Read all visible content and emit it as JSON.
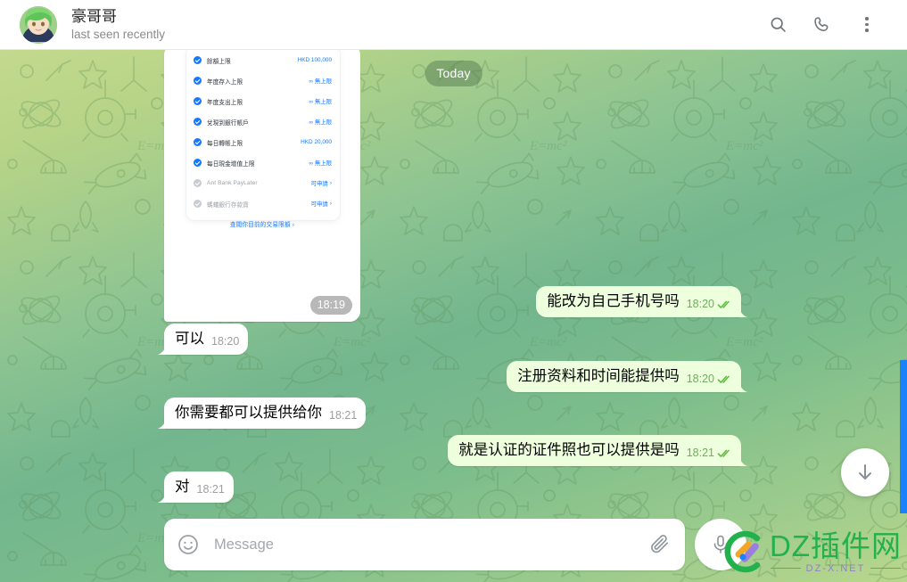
{
  "header": {
    "title": "豪哥哥",
    "subtitle": "last seen recently",
    "search_icon": "search-icon",
    "call_icon": "phone-icon",
    "menu_icon": "more-vertical-icon"
  },
  "chat": {
    "date_divider": "Today",
    "photo_message": {
      "time": "18:19",
      "card_rows": [
        {
          "label": "餘額上限",
          "value": "HKD 100,000",
          "enabled": true,
          "chevron": false
        },
        {
          "label": "年度存入上限",
          "value": "∞ 無上限",
          "enabled": true,
          "chevron": false
        },
        {
          "label": "年度支出上限",
          "value": "∞ 無上限",
          "enabled": true,
          "chevron": false
        },
        {
          "label": "兌現到銀行帳戶",
          "value": "∞ 無上限",
          "enabled": true,
          "chevron": false
        },
        {
          "label": "每日轉帳上限",
          "value": "HKD 20,000",
          "enabled": true,
          "chevron": false
        },
        {
          "label": "每日現金增值上限",
          "value": "∞ 無上限",
          "enabled": true,
          "chevron": false
        },
        {
          "label": "Ant Bank PayLater",
          "value": "可申請",
          "enabled": false,
          "chevron": true
        },
        {
          "label": "螞蟻銀行存款寶",
          "value": "可申請",
          "enabled": false,
          "chevron": true
        }
      ],
      "card_link": "查閱你目前的交易限額 ›"
    },
    "messages": [
      {
        "text": "能改为自己手机号吗",
        "time": "18:20",
        "side": "out",
        "status": "read"
      },
      {
        "text": "可以",
        "time": "18:20",
        "side": "in",
        "status": ""
      },
      {
        "text": "注册资料和时间能提供吗",
        "time": "18:20",
        "side": "out",
        "status": "read"
      },
      {
        "text": "你需要都可以提供给你",
        "time": "18:21",
        "side": "in",
        "status": ""
      },
      {
        "text": "就是认证的证件照也可以提供是吗",
        "time": "18:21",
        "side": "out",
        "status": "read"
      },
      {
        "text": "对",
        "time": "18:21",
        "side": "in",
        "status": ""
      }
    ],
    "scroll_down_icon": "arrow-down-icon"
  },
  "composer": {
    "emoji_icon": "smiley-icon",
    "placeholder": "Message",
    "value": "",
    "attach_icon": "paperclip-icon",
    "mic_icon": "microphone-icon"
  },
  "watermark": {
    "title": "DZ插件网",
    "subtitle": "DZ-X.NET",
    "logo_icon": "dz-logo-icon"
  },
  "colors": {
    "outgoing_bubble": "#eeffdd",
    "incoming_bubble": "#ffffff",
    "accent_green": "#22b14c",
    "scrollbar": "#1a82fb",
    "card_blue": "#1677ff"
  }
}
